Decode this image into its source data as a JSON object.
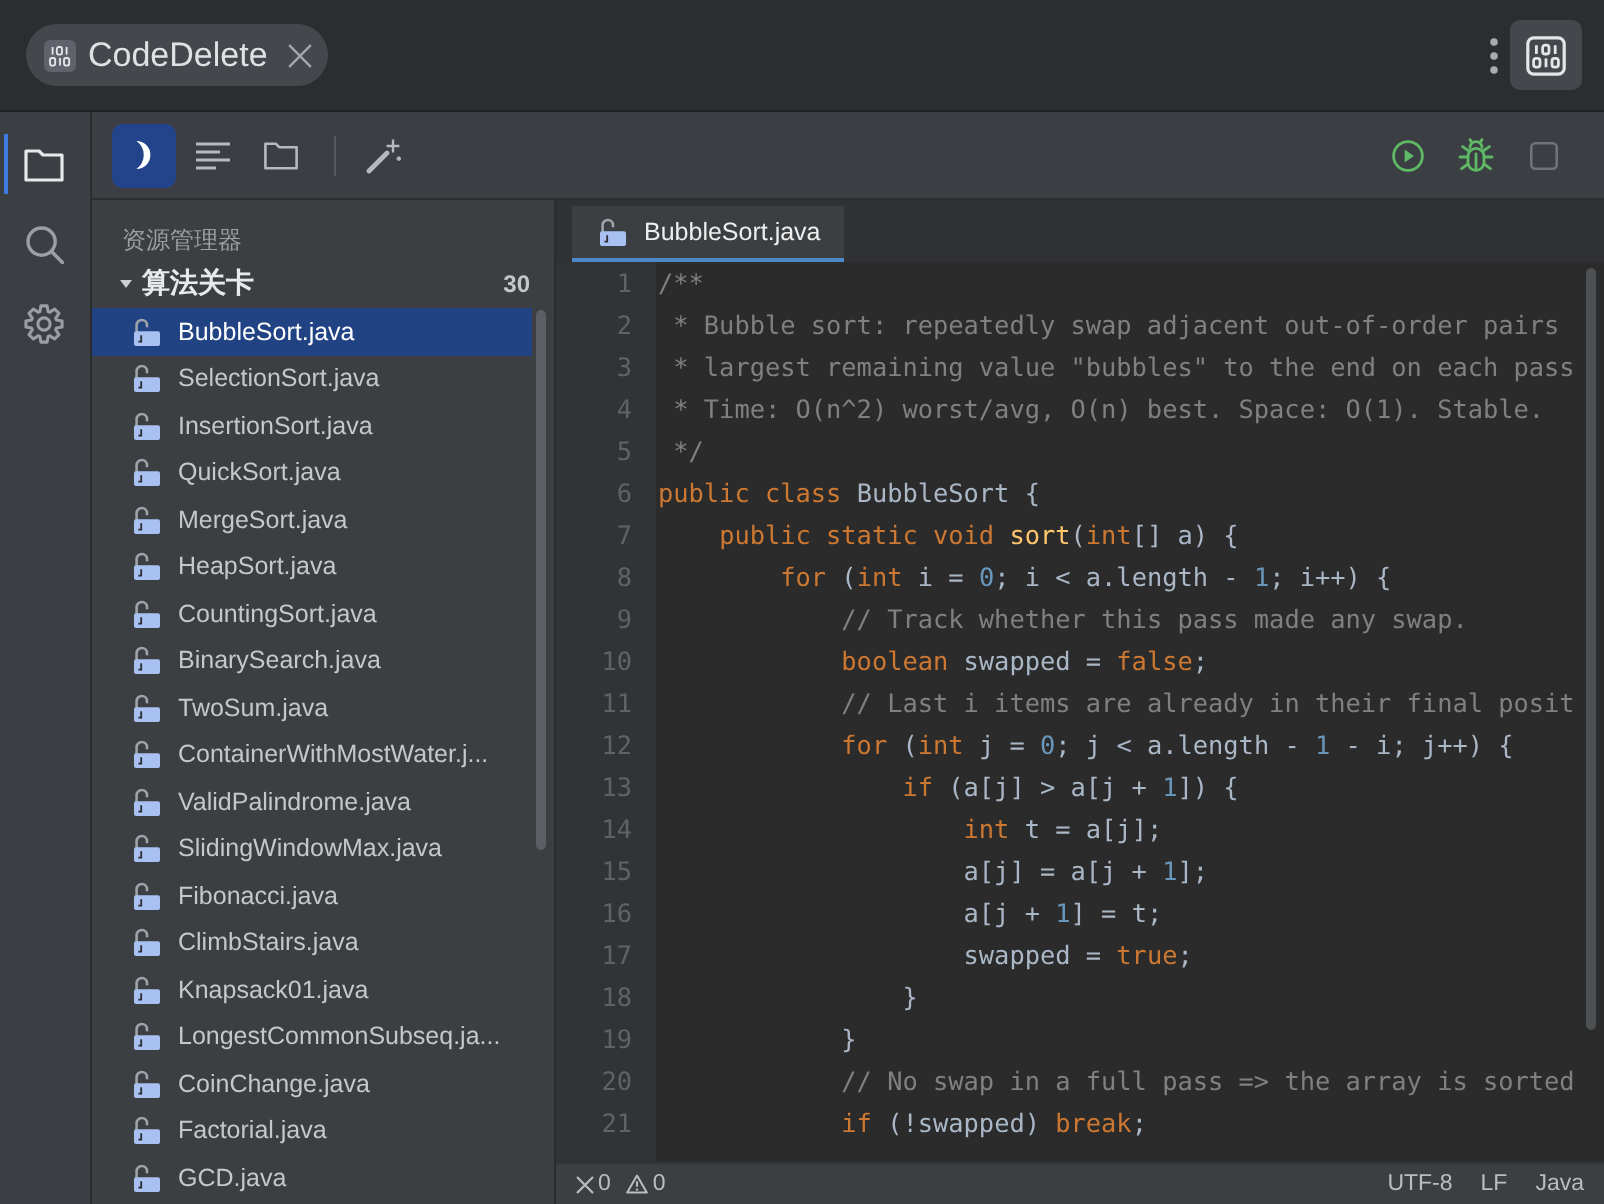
{
  "app_tab": {
    "label": "CodeDelete"
  },
  "activity_bar": {
    "items": [
      {
        "selected": true
      },
      {
        "selected": false
      },
      {
        "selected": false
      }
    ]
  },
  "toolbar": {
    "left": [
      {
        "selected": true
      },
      {
        "selected": false
      },
      {
        "selected": false
      },
      {
        "selected": false
      }
    ],
    "right": [
      {
        "disabled": false
      },
      {
        "disabled": false
      },
      {
        "disabled": true
      }
    ]
  },
  "explorer": {
    "title": "资源管理器",
    "folder": {
      "name": "算法关卡",
      "count": "30",
      "expanded": true,
      "files": [
        {
          "name": "BubbleSort.java",
          "selected": true
        },
        {
          "name": "SelectionSort.java",
          "selected": false
        },
        {
          "name": "InsertionSort.java",
          "selected": false
        },
        {
          "name": "QuickSort.java",
          "selected": false
        },
        {
          "name": "MergeSort.java",
          "selected": false
        },
        {
          "name": "HeapSort.java",
          "selected": false
        },
        {
          "name": "CountingSort.java",
          "selected": false
        },
        {
          "name": "BinarySearch.java",
          "selected": false
        },
        {
          "name": "TwoSum.java",
          "selected": false
        },
        {
          "name": "ContainerWithMostWater.j...",
          "selected": false
        },
        {
          "name": "ValidPalindrome.java",
          "selected": false
        },
        {
          "name": "SlidingWindowMax.java",
          "selected": false
        },
        {
          "name": "Fibonacci.java",
          "selected": false
        },
        {
          "name": "ClimbStairs.java",
          "selected": false
        },
        {
          "name": "Knapsack01.java",
          "selected": false
        },
        {
          "name": "LongestCommonSubseq.ja...",
          "selected": false
        },
        {
          "name": "CoinChange.java",
          "selected": false
        },
        {
          "name": "Factorial.java",
          "selected": false
        },
        {
          "name": "GCD.java",
          "selected": false
        }
      ]
    }
  },
  "editor": {
    "tabs": [
      {
        "label": "BubbleSort.java",
        "selected": true
      }
    ],
    "lines": [
      {
        "number": "1",
        "tokens": [
          {
            "text": "/**",
            "kind": "comment"
          }
        ]
      },
      {
        "number": "2",
        "tokens": [
          {
            "text": " * Bubble sort: repeatedly swap adjacent out-of-order pairs",
            "kind": "comment"
          }
        ]
      },
      {
        "number": "3",
        "tokens": [
          {
            "text": " * largest remaining value \"bubbles\" to the end on each pass",
            "kind": "comment"
          }
        ]
      },
      {
        "number": "4",
        "tokens": [
          {
            "text": " * Time: O(n^2) worst/avg, O(n) best. Space: O(1). Stable.",
            "kind": "comment"
          }
        ]
      },
      {
        "number": "5",
        "tokens": [
          {
            "text": " */",
            "kind": "comment"
          }
        ]
      },
      {
        "number": "6",
        "tokens": [
          {
            "text": "public class ",
            "kind": "keyword"
          },
          {
            "text": "BubbleSort {",
            "kind": "plain"
          }
        ]
      },
      {
        "number": "7",
        "tokens": [
          {
            "text": "    public static void ",
            "kind": "keyword"
          },
          {
            "text": "sort",
            "kind": "method"
          },
          {
            "text": "(",
            "kind": "plain"
          },
          {
            "text": "int",
            "kind": "keyword"
          },
          {
            "text": "[] a) {",
            "kind": "plain"
          }
        ]
      },
      {
        "number": "8",
        "tokens": [
          {
            "text": "        for ",
            "kind": "keyword"
          },
          {
            "text": "(",
            "kind": "plain"
          },
          {
            "text": "int ",
            "kind": "keyword"
          },
          {
            "text": "i = ",
            "kind": "plain"
          },
          {
            "text": "0",
            "kind": "number"
          },
          {
            "text": "; i < a.length - ",
            "kind": "plain"
          },
          {
            "text": "1",
            "kind": "number"
          },
          {
            "text": "; i++) {",
            "kind": "plain"
          }
        ]
      },
      {
        "number": "9",
        "tokens": [
          {
            "text": "            // Track whether this pass made any swap.",
            "kind": "comment"
          }
        ]
      },
      {
        "number": "10",
        "tokens": [
          {
            "text": "            boolean ",
            "kind": "keyword"
          },
          {
            "text": "swapped = ",
            "kind": "plain"
          },
          {
            "text": "false",
            "kind": "keyword"
          },
          {
            "text": ";",
            "kind": "plain"
          }
        ]
      },
      {
        "number": "11",
        "tokens": [
          {
            "text": "            // Last i items are already in their final posit",
            "kind": "comment"
          }
        ]
      },
      {
        "number": "12",
        "tokens": [
          {
            "text": "            for ",
            "kind": "keyword"
          },
          {
            "text": "(",
            "kind": "plain"
          },
          {
            "text": "int ",
            "kind": "keyword"
          },
          {
            "text": "j = ",
            "kind": "plain"
          },
          {
            "text": "0",
            "kind": "number"
          },
          {
            "text": "; j < a.length - ",
            "kind": "plain"
          },
          {
            "text": "1",
            "kind": "number"
          },
          {
            "text": " - i; j++) {",
            "kind": "plain"
          }
        ]
      },
      {
        "number": "13",
        "tokens": [
          {
            "text": "                if ",
            "kind": "keyword"
          },
          {
            "text": "(a[j] > a[j + ",
            "kind": "plain"
          },
          {
            "text": "1",
            "kind": "number"
          },
          {
            "text": "]) {",
            "kind": "plain"
          }
        ]
      },
      {
        "number": "14",
        "tokens": [
          {
            "text": "                    int ",
            "kind": "keyword"
          },
          {
            "text": "t = a[j];",
            "kind": "plain"
          }
        ]
      },
      {
        "number": "15",
        "tokens": [
          {
            "text": "                    a[j] = a[j + ",
            "kind": "plain"
          },
          {
            "text": "1",
            "kind": "number"
          },
          {
            "text": "];",
            "kind": "plain"
          }
        ]
      },
      {
        "number": "16",
        "tokens": [
          {
            "text": "                    a[j + ",
            "kind": "plain"
          },
          {
            "text": "1",
            "kind": "number"
          },
          {
            "text": "] = t;",
            "kind": "plain"
          }
        ]
      },
      {
        "number": "17",
        "tokens": [
          {
            "text": "                    swapped = ",
            "kind": "plain"
          },
          {
            "text": "true",
            "kind": "keyword"
          },
          {
            "text": ";",
            "kind": "plain"
          }
        ]
      },
      {
        "number": "18",
        "tokens": [
          {
            "text": "                }",
            "kind": "plain"
          }
        ]
      },
      {
        "number": "19",
        "tokens": [
          {
            "text": "            }",
            "kind": "plain"
          }
        ]
      },
      {
        "number": "20",
        "tokens": [
          {
            "text": "            // No swap in a full pass => the array is sorted",
            "kind": "comment"
          }
        ]
      },
      {
        "number": "21",
        "tokens": [
          {
            "text": "            if ",
            "kind": "keyword"
          },
          {
            "text": "(!swapped) ",
            "kind": "plain"
          },
          {
            "text": "break",
            "kind": "keyword"
          },
          {
            "text": ";",
            "kind": "plain"
          }
        ]
      }
    ]
  },
  "status_bar": {
    "errors": "0",
    "warnings": "0",
    "encoding": "UTF-8",
    "line_ending": "LF",
    "language": "Java"
  }
}
